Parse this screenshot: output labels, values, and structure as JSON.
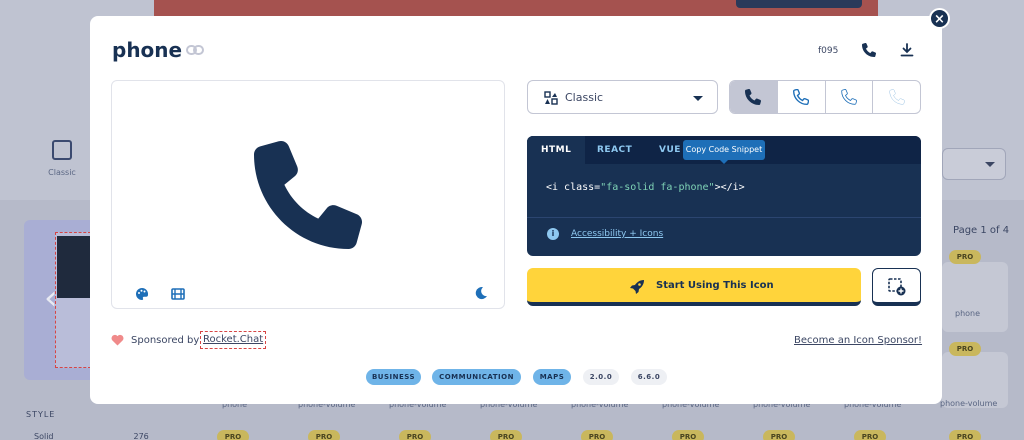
{
  "background": {
    "style_filter_label": "Classic",
    "sidebar_heading": "STYLE",
    "sidebar_first_item": "Solid",
    "sidebar_first_count": "276",
    "page_indicator": "Page 1 of 4",
    "pro_badge": "PRO",
    "tile_labels": [
      "phone",
      "phone",
      "phone-volume",
      "phone-volume",
      "phone-volume",
      "phone-volume",
      "phone-volume",
      "phone-volume",
      "phone-volume",
      "phone-volume"
    ],
    "prev_arrow": "‹",
    "next_arrow": "›"
  },
  "modal": {
    "close": "×",
    "title": "phone",
    "unicode": "f095",
    "style_select": {
      "selected": "Classic"
    },
    "code": {
      "tabs": [
        "HTML",
        "REACT",
        "VUE"
      ],
      "active_tab": "HTML",
      "tooltip": "Copy Code Snippet",
      "snippet_open": "<i class=",
      "snippet_value": "\"fa-solid fa-phone\"",
      "snippet_close": "></i>",
      "a11y_link": "Accessibility + Icons"
    },
    "start_button": "Start Using This Icon",
    "sponsored_by": "Sponsored by",
    "sponsor_name": "Rocket.Chat",
    "become_sponsor": "Become an Icon Sponsor!",
    "tags": [
      "BUSINESS",
      "COMMUNICATION",
      "MAPS",
      "2.0.0",
      "6.6.0"
    ]
  },
  "colors": {
    "navy": "#183153",
    "yellow": "#ffd43b",
    "accent_blue": "#1e6fb8",
    "tag_blue": "#6fb4e8"
  }
}
